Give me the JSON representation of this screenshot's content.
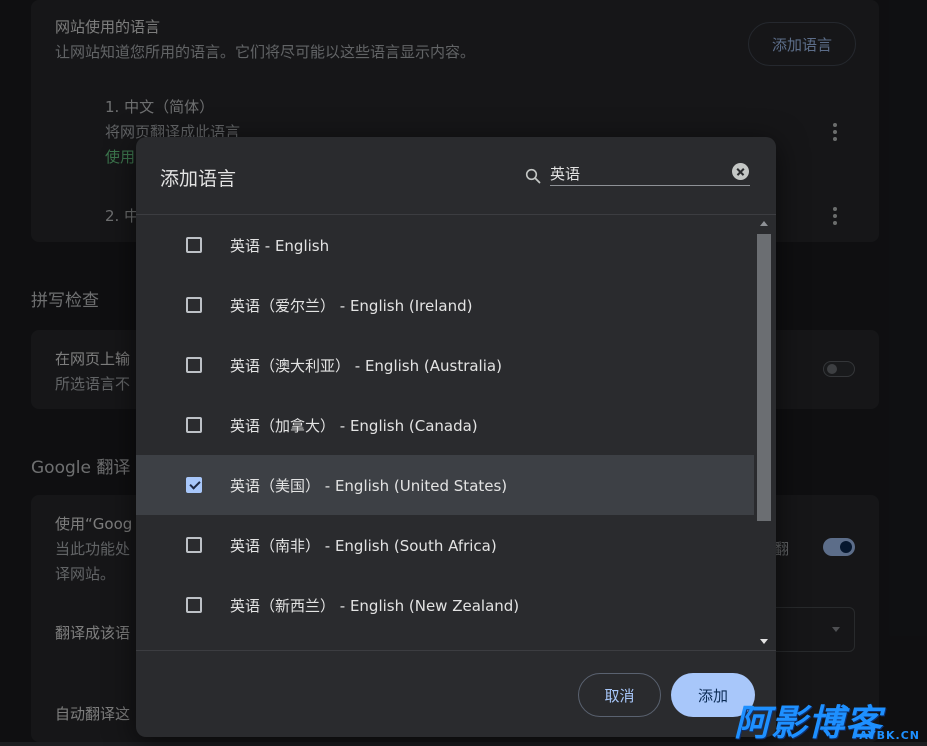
{
  "background": {
    "languages_section": {
      "title": "网站使用的语言",
      "description": "让网站知道您所用的语言。它们将尽可能以这些语言显示内容。",
      "add_language_button": "添加语言",
      "items": [
        {
          "name": "1. 中文（简体）",
          "sub": "将网页翻译成此语言",
          "sub2": "使用"
        },
        {
          "name": "2. 中"
        }
      ]
    },
    "spellcheck": {
      "heading": "拼写检查",
      "line1": "在网页上输",
      "line2": "所选语言不"
    },
    "translate": {
      "heading": "Google 翻译",
      "line1": "使用“Goog",
      "line2": "当此功能处",
      "line3": "译网站。",
      "trailing": "翻",
      "target_label": "翻译成该语",
      "auto_label": "自动翻译这"
    }
  },
  "dialog": {
    "title": "添加语言",
    "search": {
      "value": "英语",
      "icon": "search-icon"
    },
    "languages": [
      {
        "label": "英语 - English",
        "checked": false
      },
      {
        "label": "英语（爱尔兰） - English (Ireland)",
        "checked": false
      },
      {
        "label": "英语（澳大利亚） - English (Australia)",
        "checked": false
      },
      {
        "label": "英语（加拿大） - English (Canada)",
        "checked": false
      },
      {
        "label": "英语（美国） - English (United States)",
        "checked": true
      },
      {
        "label": "英语（南非） - English (South Africa)",
        "checked": false
      },
      {
        "label": "英语（新西兰） - English (New Zealand)",
        "checked": false
      }
    ],
    "cancel_label": "取消",
    "add_label": "添加"
  },
  "watermark": {
    "main": "阿影博客",
    "sub": "AYBK.CN"
  },
  "colors": {
    "accent": "#a8c7fa",
    "dialog_bg": "#2a2b2e",
    "page_bg": "#1c1d20"
  }
}
